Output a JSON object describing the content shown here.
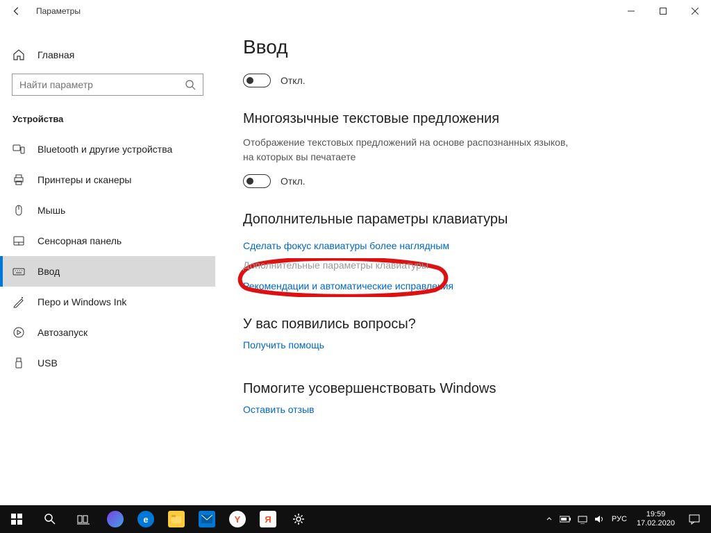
{
  "window": {
    "title": "Параметры"
  },
  "sidebar": {
    "home": "Главная",
    "search_placeholder": "Найти параметр",
    "section": "Устройства",
    "items": [
      {
        "label": "Bluetooth и другие устройства"
      },
      {
        "label": "Принтеры и сканеры"
      },
      {
        "label": "Мышь"
      },
      {
        "label": "Сенсорная панель"
      },
      {
        "label": "Ввод"
      },
      {
        "label": "Перо и Windows Ink"
      },
      {
        "label": "Автозапуск"
      },
      {
        "label": "USB"
      }
    ]
  },
  "content": {
    "title": "Ввод",
    "toggle1_label": "Откл.",
    "multilang_heading": "Многоязычные текстовые предложения",
    "multilang_desc": "Отображение текстовых предложений на основе распознанных языков, на которых вы печатаете",
    "toggle2_label": "Откл.",
    "adv_heading": "Дополнительные параметры клавиатуры",
    "link1": "Сделать фокус клавиатуры более наглядным",
    "link2": "Дополнительные параметры клавиатуры",
    "link3": "Рекомендации и автоматические исправления",
    "q_heading": "У вас появились вопросы?",
    "q_link": "Получить помощь",
    "fb_heading": "Помогите усовершенствовать Windows",
    "fb_link": "Оставить отзыв"
  },
  "taskbar": {
    "lang": "РУС",
    "time": "19:59",
    "date": "17.02.2020"
  }
}
